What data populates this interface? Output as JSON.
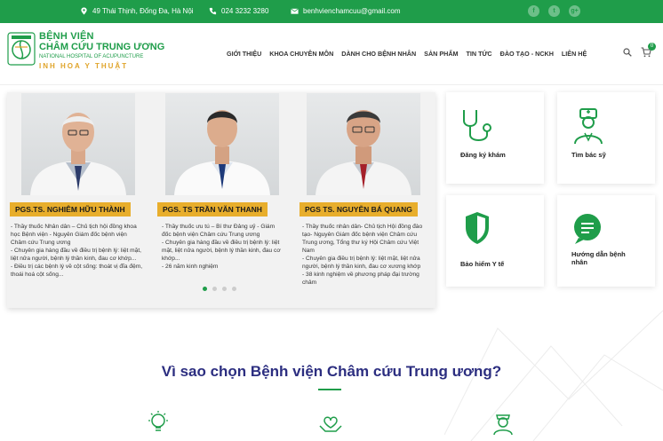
{
  "topbar": {
    "address": "49 Thái Thịnh, Đống Đa, Hà Nội",
    "phone": "024 3232 3280",
    "email": "benhvienchamcuu@gmail.com",
    "social": [
      "f",
      "t",
      "g+"
    ]
  },
  "logo": {
    "line1": "BỆNH VIỆN",
    "line2": "CHÂM CỨU TRUNG ƯƠNG",
    "line3": "NATIONAL HOSPITAL OF ACUPUNCTURE",
    "slogan": "INH HOA Y THUẬT"
  },
  "nav": [
    "GIỚI THIỆU",
    "KHOA CHUYÊN MÔN",
    "DÀNH CHO BỆNH NHÂN",
    "SẢN PHẨM",
    "TIN TỨC",
    "ĐÀO TẠO - NCKH",
    "LIÊN HỆ"
  ],
  "cart_count": "0",
  "doctors": [
    {
      "name": "PGS.TS. NGHIÊM HỮU THÀNH",
      "desc": [
        "- Thầy thuốc Nhân dân – Chủ tịch hội đồng khoa học Bệnh viện - Nguyên Giám đốc bệnh viện Châm cứu Trung ương",
        "- Chuyên gia hàng đầu về điều trị bệnh lý: liệt mặt, liệt nửa người, bệnh lý thần kinh, đau cơ khớp...",
        "- Điều trị các bệnh lý về cột sống: thoát vị đĩa đệm, thoái hoá cột sống..."
      ]
    },
    {
      "name": "PGS. TS TRẦN VĂN THANH",
      "desc": [
        "- Thầy thuốc ưu tú – Bí thư Đảng uỷ - Giám đốc bệnh viện Châm cứu Trung ương",
        "- Chuyên gia hàng đầu về điều trị bệnh lý: liệt mặt, liệt nửa người, bệnh lý thần kinh, đau cơ khớp...",
        "- 26 năm kinh nghiệm"
      ]
    },
    {
      "name": "PGS TS. NGUYỄN BÁ QUANG",
      "desc": [
        "- Thầy thuốc nhân dân- Chủ tịch Hội đồng đào tạo- Nguyên Giám đốc bệnh viện Châm cứu Trung ương, Tổng thư ký Hội Châm cứu Việt Nam",
        "- Chuyên gia điều trị bệnh lý: liệt mặt, liệt nửa người, bệnh lý thần kinh, đau cơ xương khớp",
        "- 38 kinh nghiệm về phương pháp đại trường châm"
      ]
    }
  ],
  "cards": [
    {
      "label": "Đăng ký khám",
      "icon": "stethoscope-icon"
    },
    {
      "label": "Tìm bác sỹ",
      "icon": "doctor-icon"
    },
    {
      "label": "Bảo hiểm Y tế",
      "icon": "shield-icon"
    },
    {
      "label": "Hướng dẫn bệnh nhân",
      "icon": "chat-icon"
    }
  ],
  "section_title": "Vì sao chọn Bệnh viện Châm cứu Trung ương?",
  "colors": {
    "brand": "#1f9d4a",
    "accent": "#e8ae2c",
    "title": "#2c2e80"
  }
}
